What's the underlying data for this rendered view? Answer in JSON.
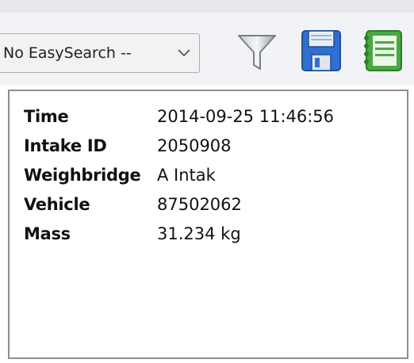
{
  "toolbar": {
    "easysearch": {
      "selected": "No EasySearch --"
    },
    "icons": [
      "filter-icon",
      "save-icon",
      "notebook-icon"
    ]
  },
  "details": {
    "rows": [
      {
        "label": "Time",
        "value": "2014-09-25 11:46:56"
      },
      {
        "label": "Intake ID",
        "value": "2050908"
      },
      {
        "label": "Weighbridge",
        "value": "A Intak"
      },
      {
        "label": "Vehicle",
        "value": "87502062"
      },
      {
        "label": "Mass",
        "value": "31.234 kg"
      }
    ]
  },
  "colors": {
    "save_blue": "#2f6fd1",
    "notebook_green": "#4aa843",
    "filter_gray": "#8a8d91"
  }
}
